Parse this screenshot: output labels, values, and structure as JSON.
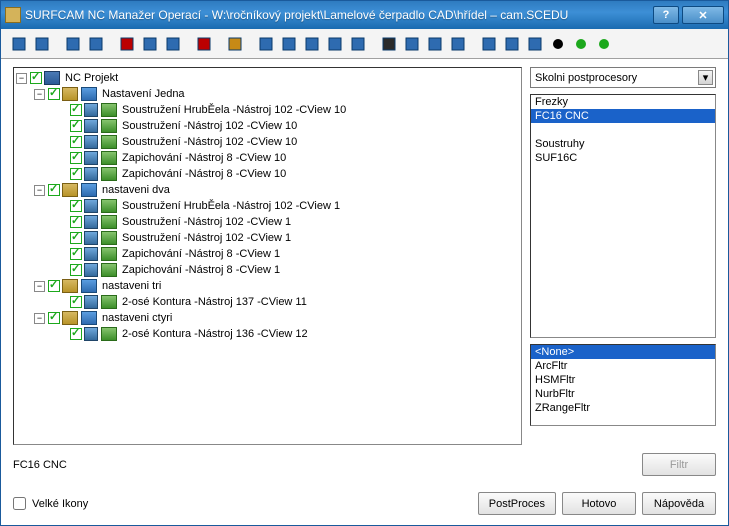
{
  "window_title": "SURFCAM NC Manažer Operací - W:\\ročníkový projekt\\Lamelové čerpadlo CAD\\hřídel – cam.SCEDU",
  "toolbar_icons": [
    "copy-stack",
    "copy",
    "paste-stack",
    "arrow-right",
    "cut",
    "copy2",
    "paste",
    "delete",
    "clock",
    "setup1",
    "setup2",
    "contour",
    "rotate",
    "path",
    "glasses",
    "tool",
    "path2",
    "play",
    "sheet1",
    "sheet2",
    "sheet3",
    "black-dot",
    "green-dot",
    "green-dot2"
  ],
  "tree": {
    "root": "NC Projekt",
    "setups": [
      {
        "name": "Nastavení Jedna",
        "ops": [
          "Soustružení HrubĚela  -Nástroj 102 -CView 10",
          "Soustružení  -Nástroj 102 -CView 10",
          "Soustružení  -Nástroj 102 -CView 10",
          "Zapichování  -Nástroj 8 -CView 10",
          "Zapichování  -Nástroj 8 -CView 10"
        ]
      },
      {
        "name": "nastaveni dva",
        "ops": [
          "Soustružení HrubĚela  -Nástroj 102 -CView 1",
          "Soustružení  -Nástroj 102 -CView 1",
          "Soustružení  -Nástroj 102 -CView 1",
          "Zapichování  -Nástroj 8 -CView 1",
          "Zapichování  -Nástroj 8 -CView 1"
        ]
      },
      {
        "name": "nastaveni tri",
        "ops": [
          "2-osé Kontura  -Nástroj 137 -CView 11"
        ]
      },
      {
        "name": "nastaveni ctyri",
        "ops": [
          "2-osé Kontura  -Nástroj 136 -CView 12"
        ]
      }
    ]
  },
  "combo_label": "Skolni postprocesory",
  "post_list": {
    "groups": [
      {
        "header": "Frezky",
        "items": [
          "FC16 CNC"
        ]
      },
      {
        "header": "Soustruhy",
        "items": [
          "SUF16C"
        ]
      }
    ],
    "selected": "FC16 CNC"
  },
  "filter_list": {
    "items": [
      "<None>",
      "ArcFltr",
      "HSMFltr",
      "NurbFltr",
      "ZRangeFltr"
    ],
    "selected": "<None>"
  },
  "status_label": "FC16 CNC",
  "buttons": {
    "filter": "Filtr",
    "postproces": "PostProces",
    "hotovo": "Hotovo",
    "napoveda": "Nápověda"
  },
  "large_icons_label": "Velké Ikony"
}
